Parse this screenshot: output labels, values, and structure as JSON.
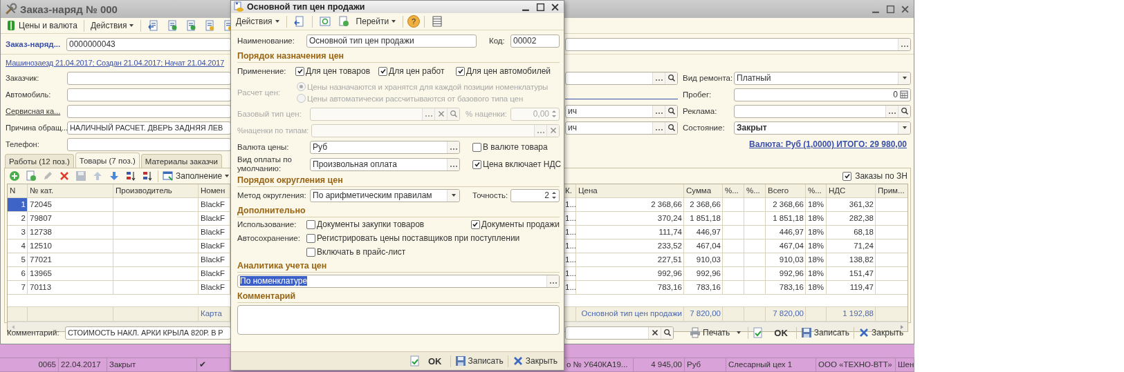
{
  "main_window": {
    "title": "Заказ-наряд № 000",
    "toolbar": {
      "prices": "Цены и валюта",
      "actions": "Действия"
    },
    "number_label": "Заказ-наряд...",
    "number": "0000000043",
    "info_link": "Машинозаезд 21.04.2017; Создан 21.04.2017; Начат 21.04.2017",
    "left_fields": [
      {
        "label": "Заказчик:",
        "link": false
      },
      {
        "label": "Автомобиль:",
        "link": false
      },
      {
        "label": "Сервисная ка...",
        "link": true
      },
      {
        "label": "Причина обращ...",
        "link": false,
        "value": "НАЛИЧНЫЙ РАСЧЕТ. ДВЕРЬ ЗАДНЯЯ ЛЕВ"
      },
      {
        "label": "Телефон:",
        "link": false
      }
    ],
    "middle_fields": [
      {
        "kind": "choice"
      },
      {
        "kind": "link"
      },
      {
        "kind": "choice",
        "value": "ич"
      },
      {
        "kind": "choice",
        "value": "ич"
      }
    ],
    "right_fields": [
      {
        "label": "Вид ремонта:",
        "kind": "dropdown",
        "value": "Платный",
        "bold": false
      },
      {
        "label": "Пробег:",
        "kind": "number",
        "value": "0",
        "bold": false
      },
      {
        "label": "Реклама:",
        "kind": "choice"
      },
      {
        "label": "Состояние:",
        "kind": "dropdown",
        "value": "Закрыт",
        "bold": true
      }
    ],
    "total_link": "Валюта: Руб (1,0000) ИТОГО: 29 980,00",
    "tabs": [
      {
        "label": "Работы (12 поз.)",
        "selected": false
      },
      {
        "label": "Товары (7 поз.)",
        "selected": true
      },
      {
        "label": "Материалы заказчи",
        "selected": false
      }
    ],
    "table_toolbar": {
      "fill": "Заполнение"
    },
    "orders_checkbox": {
      "label": "Заказы по ЗН",
      "checked": true
    },
    "table": {
      "columns_left": [
        "N",
        "№ кат.",
        "Производитель",
        "Номен"
      ],
      "columns_right": [
        "К.",
        "Цена",
        "Сумма",
        "%...",
        "%...",
        "Всего",
        "%...",
        "НДС",
        "Прим..."
      ],
      "rows": [
        {
          "selected": true,
          "n": "1",
          "cat": "72045",
          "name": "BlackF",
          "k": "1...",
          "price": "2 368,66",
          "sum": "2 368,66",
          "total": "2 368,66",
          "vat_rate": "18%",
          "vat": "361,32"
        },
        {
          "selected": false,
          "n": "2",
          "cat": "79807",
          "name": "BlackF",
          "k": "1...",
          "price": "370,24",
          "sum": "1 851,18",
          "total": "1 851,18",
          "vat_rate": "18%",
          "vat": "282,38"
        },
        {
          "selected": false,
          "n": "3",
          "cat": "12738",
          "name": "BlackF",
          "k": "1...",
          "price": "111,74",
          "sum": "446,97",
          "total": "446,97",
          "vat_rate": "18%",
          "vat": "68,18"
        },
        {
          "selected": false,
          "n": "4",
          "cat": "12510",
          "name": "BlackF",
          "k": "1...",
          "price": "233,52",
          "sum": "467,04",
          "total": "467,04",
          "vat_rate": "18%",
          "vat": "71,24"
        },
        {
          "selected": false,
          "n": "5",
          "cat": "77021",
          "name": "BlackF",
          "k": "1...",
          "price": "227,51",
          "sum": "910,03",
          "total": "910,03",
          "vat_rate": "18%",
          "vat": "138,82"
        },
        {
          "selected": false,
          "n": "6",
          "cat": "13965",
          "name": "BlackF",
          "k": "1...",
          "price": "992,96",
          "sum": "992,96",
          "total": "992,96",
          "vat_rate": "18%",
          "vat": "151,47"
        },
        {
          "selected": false,
          "n": "7",
          "cat": "70113",
          "name": "BlackF",
          "k": "1...",
          "price": "783,16",
          "sum": "783,16",
          "total": "783,16",
          "vat_rate": "18%",
          "vat": "119,47"
        }
      ],
      "footer": {
        "card": "Карта",
        "price_type": "Основной тип цен продажи",
        "sum": "7 820,00",
        "total": "7 820,00",
        "vat": "1 192,88"
      }
    },
    "comment": {
      "label": "Комментарий:",
      "value": "СТОИМОСТЬ НАКЛ. АРКИ КРЫЛА 820Р. В Р"
    },
    "buttons": {
      "print": "Печать",
      "ok": "OK",
      "save": "Записать",
      "close": "Закрыть"
    }
  },
  "background_list": [
    {
      "number": "0065",
      "date": "22.04.2017",
      "status": "Закрыт",
      "mark": "✔",
      "car": "о № У640КА19...",
      "amount": "4 945,00",
      "currency": "Руб",
      "department": "Слесарный цех 1",
      "company": "ООО «ТЕХНО-ВТТ»",
      "column_last": "Шен"
    }
  ],
  "dialog": {
    "title": "Основной тип цен продажи",
    "toolbar": {
      "actions": "Действия",
      "goto": "Перейти",
      "help": "?"
    },
    "name": {
      "label": "Наименование:",
      "value": "Основной тип цен продажи"
    },
    "code": {
      "label": "Код:",
      "value": "00002"
    },
    "section_assign": "Порядок назначения цен",
    "usage": {
      "label": "Применение:",
      "options": [
        {
          "label": "Для цен товаров",
          "checked": true
        },
        {
          "label": "Для цен работ",
          "checked": true
        },
        {
          "label": "Для цен автомобилей",
          "checked": true
        }
      ]
    },
    "calc": {
      "label": "Расчет цен:",
      "disabled": true,
      "options": [
        {
          "label": "Цены назначаются и хранятся для каждой позиции номенклатуры",
          "selected": true
        },
        {
          "label": "Цены автоматически рассчитываются от базового типа цен",
          "selected": false
        }
      ]
    },
    "base_type": {
      "label": "Базовый тип цен:",
      "disabled": true
    },
    "markup": {
      "label": "% наценки:",
      "value": "0,00",
      "disabled": true
    },
    "markup_by_types": {
      "label": "%наценки по типам:",
      "disabled": true
    },
    "currency": {
      "label": "Валюта цены:",
      "value": "Руб"
    },
    "in_goods_currency": {
      "label": "В валюте товара",
      "checked": false
    },
    "payment": {
      "label": "Вид оплаты по умолчанию:",
      "value": "Произвольная оплата"
    },
    "vat_included": {
      "label": "Цена включает НДС",
      "checked": true
    },
    "section_rounding": "Порядок округления цен",
    "rounding": {
      "label": "Метод округления:",
      "value": "По арифметическим правилам"
    },
    "precision": {
      "label": "Точность:",
      "value": "2"
    },
    "section_extra": "Дополнительно",
    "use_label": "Использование:",
    "purchase_docs": {
      "label": "Документы закупки товаров",
      "checked": false
    },
    "sale_docs": {
      "label": "Документы продажи",
      "checked": true
    },
    "autosave_label": "Автосохранение:",
    "register_prices": {
      "label": "Регистрировать цены поставщиков при поступлении",
      "checked": false
    },
    "price_list": {
      "label": "Включать в прайс-лист",
      "checked": false
    },
    "section_analytics": "Аналитика учета цен",
    "analytics": {
      "value": "По номенклатуре",
      "selected": true
    },
    "section_comment": "Комментарий",
    "buttons": {
      "ok": "OK",
      "save": "Записать",
      "close": "Закрыть"
    }
  }
}
